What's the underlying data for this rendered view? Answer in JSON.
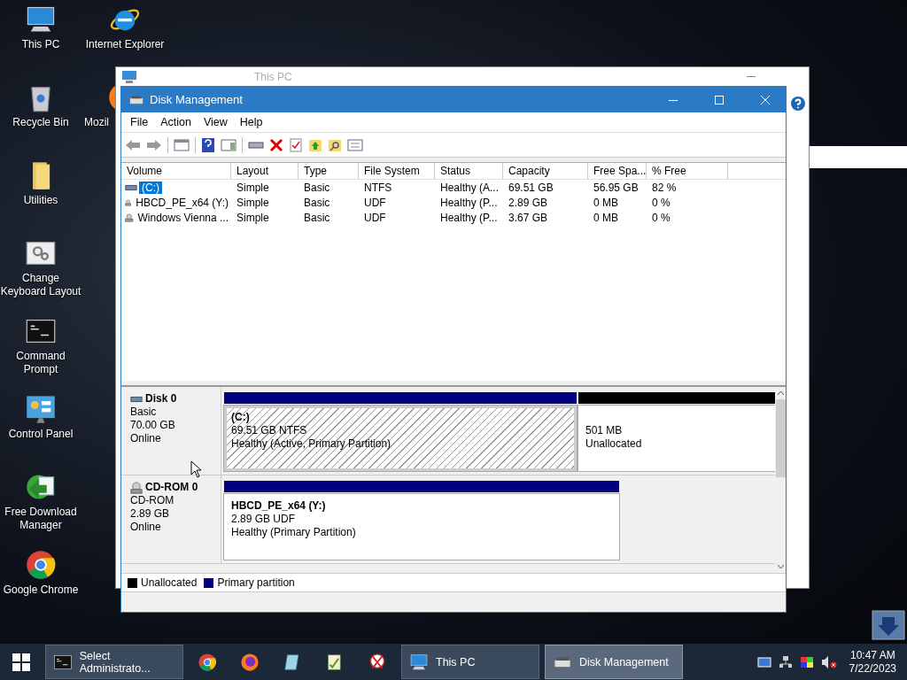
{
  "desktop": {
    "columns": [
      [
        {
          "label": "This PC",
          "kind": "pc"
        },
        {
          "label": "Recycle Bin",
          "kind": "bin"
        },
        {
          "label": "Utilities",
          "kind": "folder"
        },
        {
          "label": "Change Keyboard Layout",
          "kind": "gears"
        },
        {
          "label": "Command Prompt",
          "kind": "cmd"
        },
        {
          "label": "Control Panel",
          "kind": "panel"
        },
        {
          "label": "Free Download Manager",
          "kind": "download"
        },
        {
          "label": "Google Chrome",
          "kind": "chrome"
        }
      ],
      [
        {
          "label": "Internet Explorer",
          "kind": "ie"
        },
        {
          "label": "Mozil",
          "kind": "firefox"
        }
      ]
    ]
  },
  "background_window": {
    "title": "This PC"
  },
  "window": {
    "title": "Disk Management",
    "menu": [
      "File",
      "Action",
      "View",
      "Help"
    ],
    "table": {
      "columns": [
        "Volume",
        "Layout",
        "Type",
        "File System",
        "Status",
        "Capacity",
        "Free Spa...",
        "% Free"
      ],
      "rows": [
        {
          "kind": "disk",
          "selected": true,
          "cells": [
            "(C:)",
            "Simple",
            "Basic",
            "NTFS",
            "Healthy (A...",
            "69.51 GB",
            "56.95 GB",
            "82 %"
          ]
        },
        {
          "kind": "cd",
          "selected": false,
          "cells": [
            "HBCD_PE_x64 (Y:)",
            "Simple",
            "Basic",
            "UDF",
            "Healthy (P...",
            "2.89 GB",
            "0 MB",
            "0 %"
          ]
        },
        {
          "kind": "cd",
          "selected": false,
          "cells": [
            "Windows Vienna ...",
            "Simple",
            "Basic",
            "UDF",
            "Healthy (P...",
            "3.67 GB",
            "0 MB",
            "0 %"
          ]
        }
      ]
    },
    "disks": [
      {
        "name": "Disk 0",
        "kind": "disk",
        "type": "Basic",
        "size": "70.00 GB",
        "status": "Online",
        "partitions": [
          {
            "kind": "primary",
            "selected": true,
            "label": "(C:)",
            "size": "69.51 GB NTFS",
            "status": "Healthy (Active, Primary Partition)"
          },
          {
            "kind": "unallocated",
            "selected": false,
            "size": "501 MB",
            "status": "Unallocated"
          }
        ]
      },
      {
        "name": "CD-ROM 0",
        "kind": "cd",
        "type": "CD-ROM",
        "size": "2.89 GB",
        "status": "Online",
        "partitions": [
          {
            "kind": "primary",
            "selected": false,
            "label": "HBCD_PE_x64  (Y:)",
            "size": "2.89 GB UDF",
            "status": "Healthy (Primary Partition)"
          }
        ]
      }
    ],
    "legend": [
      {
        "label": "Unallocated",
        "color": "#000000"
      },
      {
        "label": "Primary partition",
        "color": "#000080"
      }
    ]
  },
  "taskbar": {
    "items": [
      {
        "kind": "cmd",
        "label": "Select Administrato...",
        "active": false
      },
      {
        "kind": "chrome"
      },
      {
        "kind": "firefox"
      },
      {
        "kind": "notes"
      },
      {
        "kind": "editor"
      },
      {
        "kind": "snip"
      },
      {
        "kind": "pc",
        "label": "This PC",
        "active": false
      },
      {
        "kind": "diskmgmt",
        "label": "Disk Management",
        "active": true
      }
    ],
    "clock": {
      "time": "10:47 AM",
      "date": "7/22/2023"
    }
  }
}
